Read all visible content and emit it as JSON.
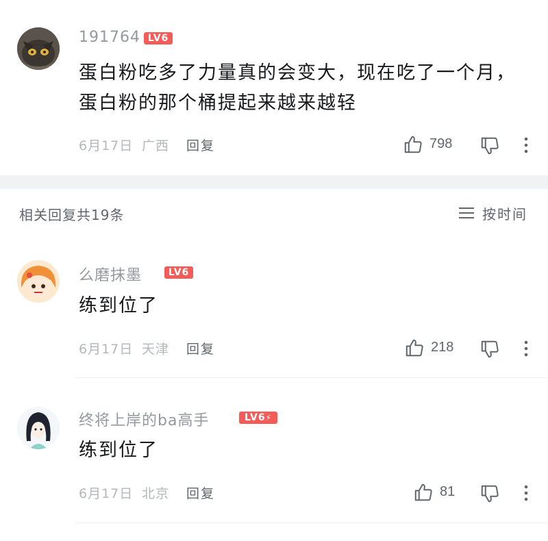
{
  "main_comment": {
    "username": "191764",
    "level": "LV6",
    "content_line1": "蛋白粉吃多了力量真的会变大，现在吃了一个月，",
    "content_line2": "蛋白粉的那个桶提起来越来越轻",
    "date": "6月17日",
    "location": "广西",
    "reply_label": "回复",
    "likes": "798"
  },
  "replies_header": {
    "title": "相关回复共19条",
    "sort_label": "按时间"
  },
  "replies": [
    {
      "username": "么磨抹墨",
      "level": "LV6",
      "content": "练到位了",
      "date": "6月17日",
      "location": "天津",
      "reply_label": "回复",
      "likes": "218"
    },
    {
      "username": "终将上岸的ba高手",
      "level": "LV6",
      "content": "练到位了",
      "date": "6月17日",
      "location": "北京",
      "reply_label": "回复",
      "likes": "81"
    }
  ],
  "icons": {
    "like": "thumbs-up-icon",
    "dislike": "thumbs-down-icon",
    "more": "more-vertical-icon",
    "sort": "sort-lines-icon"
  },
  "colors": {
    "level_badge": "#f25d59",
    "username": "#9499a0",
    "meta": "#b3b6bb",
    "section_gap": "#f1f2f3"
  }
}
